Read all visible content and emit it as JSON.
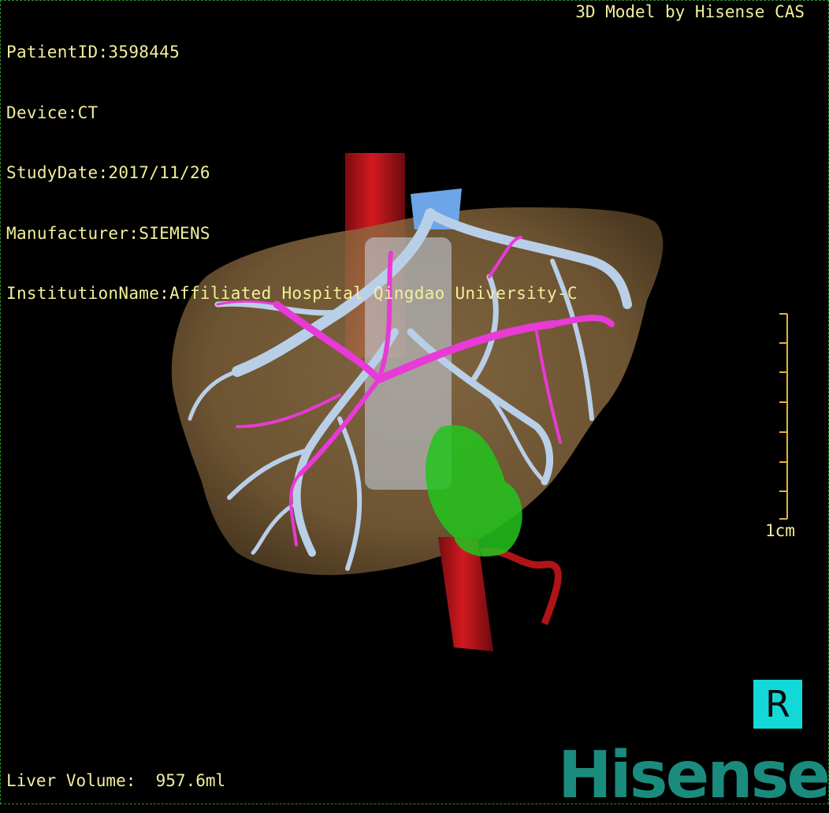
{
  "info": {
    "patient_id": "PatientID:3598445",
    "device": "Device:CT",
    "study_date": "StudyDate:2017/11/26",
    "manufacturer": "Manufacturer:SIEMENS",
    "institution": "InstitutionName:Affiliated Hospital Qingdao University-C"
  },
  "model_credit": "3D Model by Hisense CAS",
  "scale_label": "1cm",
  "orientation": "R",
  "volume": "Liver Volume:  957.6ml",
  "logo": "Hisense",
  "colors": {
    "liver": "#8c6a3e",
    "portal_vein": "#b9cfe8",
    "hepatic_artery": "#e83ad6",
    "aorta": "#c4141a",
    "gallbladder": "#22c41d",
    "text": "#f2ef9a",
    "orientation_bg": "#13d8d8",
    "logo": "#1a8c7e"
  },
  "icons": {
    "orientation": "orientation-cube-icon"
  }
}
